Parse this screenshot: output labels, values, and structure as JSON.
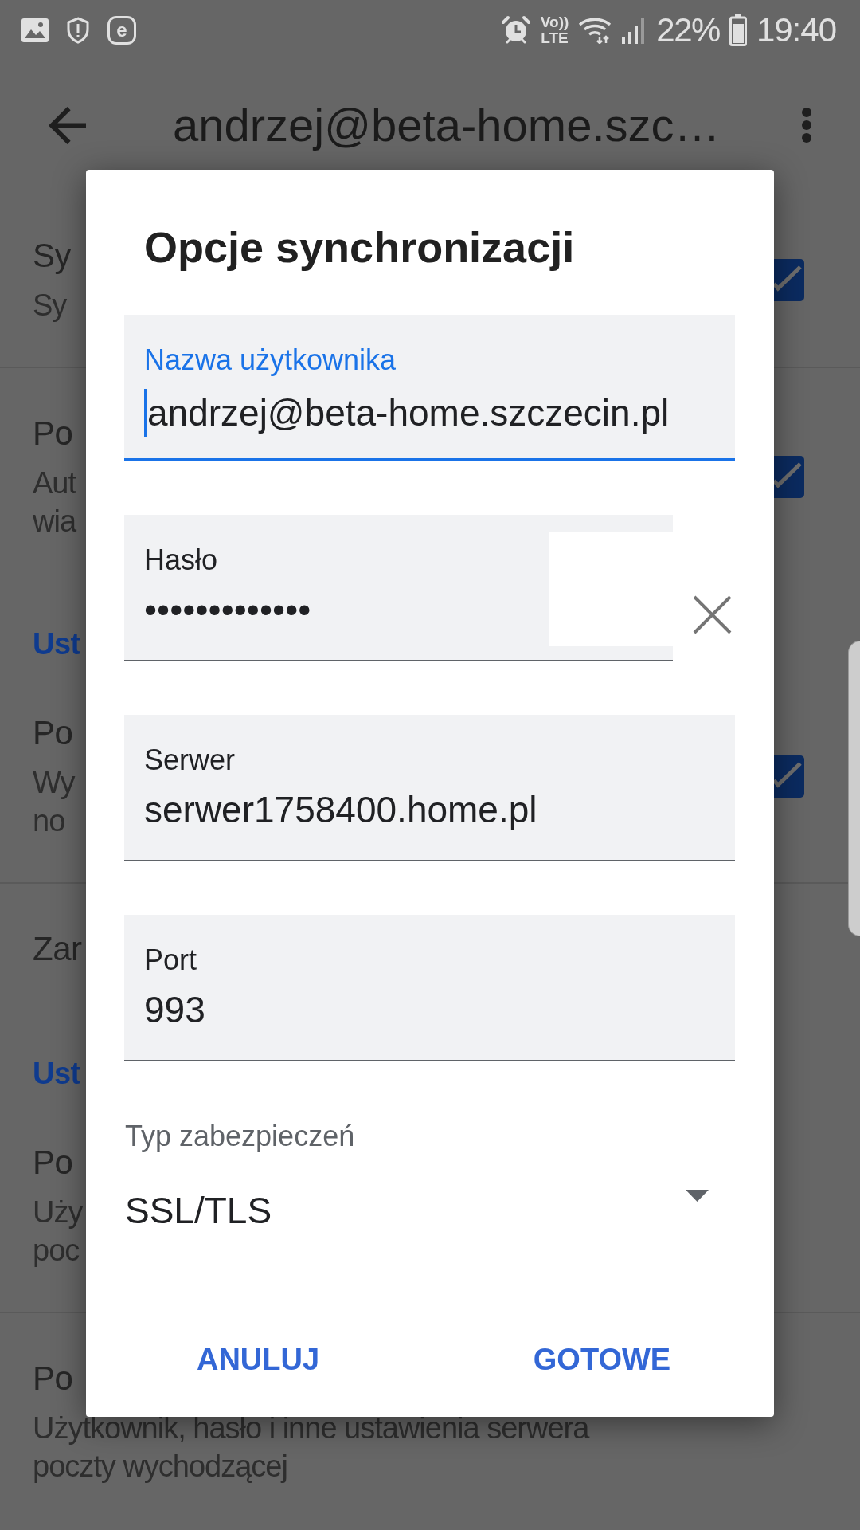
{
  "status_bar": {
    "app_badge": "e",
    "network_type": [
      "Vo))",
      "LTE"
    ],
    "battery": "22%",
    "time": "19:40"
  },
  "app_bar": {
    "title": "andrzej@beta-home.szc…"
  },
  "settings": [
    {
      "kind": "checkbox",
      "title": "Sy",
      "description": [
        "Sy"
      ],
      "checked": true
    },
    {
      "kind": "checkbox",
      "title": "Po",
      "description": [
        "Aut",
        "wia"
      ],
      "checked": true
    },
    {
      "kind": "header",
      "title": "Ust"
    },
    {
      "kind": "checkbox",
      "title": "Po",
      "description": [
        "Wy",
        "no"
      ],
      "checked": true
    },
    {
      "kind": "text",
      "title": "Zar"
    },
    {
      "kind": "header",
      "title": "Ust"
    },
    {
      "kind": "text",
      "title": "Po",
      "description": [
        "Uży",
        "poc"
      ]
    },
    {
      "kind": "text",
      "title": "Po",
      "description": [
        "Użytkownik, hasło i inne ustawienia serwera",
        "poczty wychodzącej"
      ]
    }
  ],
  "dialog": {
    "title": "Opcje synchronizacji",
    "fields": [
      {
        "kind": "text",
        "label": "Nazwa użytkownika",
        "value": "andrzej@beta-home.szczecin.pl",
        "focused": true
      },
      {
        "kind": "password",
        "label": "Hasło",
        "value": "•••••••••••••",
        "focused": false
      },
      {
        "kind": "text",
        "label": "Serwer",
        "value": "serwer1758400.home.pl",
        "focused": false
      },
      {
        "kind": "text",
        "label": "Port",
        "value": "993",
        "focused": false
      }
    ],
    "security_type": {
      "label": "Typ zabezpieczeń",
      "value": "SSL/TLS"
    },
    "buttons": [
      {
        "label": "ANULUJ"
      },
      {
        "label": "GOTOWE"
      }
    ]
  }
}
